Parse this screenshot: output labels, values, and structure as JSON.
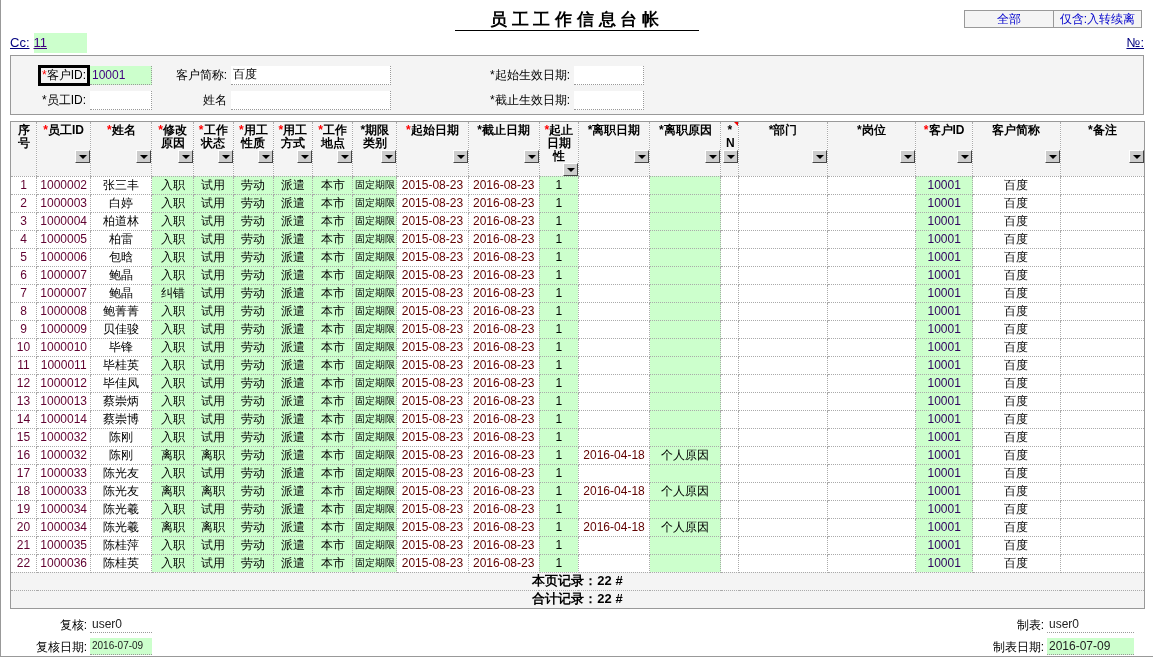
{
  "title": "员 工 工 作 信 息 台 帐",
  "filter_buttons": [
    {
      "label": "全部"
    },
    {
      "label": "仅含:入转续离"
    }
  ],
  "cc": {
    "label": "Cc:",
    "value": "11"
  },
  "number_label": "№:",
  "filters": [
    {
      "asterisk": "*",
      "required": true,
      "label": "客户ID:",
      "value": "10001",
      "highlight": true,
      "focused": true
    },
    {
      "label": "客户简称:",
      "value": "百度",
      "highlight": false,
      "focused": false
    },
    {
      "asterisk": "*",
      "required": false,
      "label": "起始生效日期:",
      "highlight": false,
      "focused": false
    },
    {
      "asterisk": "*",
      "required": false,
      "label": "员工ID:",
      "highlight": false,
      "focused": false
    },
    {
      "label": "姓名",
      "highlight": false,
      "focused": false
    },
    {
      "asterisk": "*",
      "required": false,
      "label": "截止生效日期:",
      "highlight": false,
      "focused": false
    }
  ],
  "table": {
    "columns": [
      {
        "label": "序号",
        "highlight": false,
        "dropdown": false
      },
      {
        "label": "员工ID",
        "asterisk": "*",
        "required": true,
        "highlight": false,
        "dropdown": true
      },
      {
        "label": "姓名",
        "asterisk": "*",
        "required": true,
        "highlight": false,
        "dropdown": true
      },
      {
        "label": "修改原因",
        "asterisk": "*",
        "required": true,
        "highlight": true,
        "dropdown": true
      },
      {
        "label": "工作状态",
        "asterisk": "*",
        "required": true,
        "highlight": true,
        "dropdown": true
      },
      {
        "label": "用工性质",
        "asterisk": "*",
        "required": true,
        "highlight": true,
        "dropdown": true
      },
      {
        "label": "用工方式",
        "asterisk": "*",
        "required": true,
        "highlight": true,
        "dropdown": true
      },
      {
        "label": "工作地点",
        "asterisk": "*",
        "required": true,
        "highlight": true,
        "dropdown": true
      },
      {
        "label": "期限类别",
        "asterisk": "*",
        "required": false,
        "highlight": true,
        "dropdown": true
      },
      {
        "label": "起始日期",
        "asterisk": "*",
        "required": true,
        "highlight": false,
        "dropdown": true
      },
      {
        "label": "截止日期",
        "asterisk": "*",
        "required": false,
        "highlight": false,
        "dropdown": true
      },
      {
        "label": "起止日期性",
        "asterisk": "*",
        "required": true,
        "highlight": true,
        "dropdown": true
      },
      {
        "label": "离职日期",
        "asterisk": "*",
        "required": false,
        "highlight": false,
        "dropdown": true
      },
      {
        "label": "离职原因",
        "asterisk": "*",
        "required": false,
        "highlight": true,
        "dropdown": true
      },
      {
        "label": "N",
        "asterisk": "*",
        "required": false,
        "highlight": false,
        "dropdown": true,
        "has_comment": true
      },
      {
        "label": "部门",
        "asterisk": "*",
        "required": false,
        "highlight": false,
        "dropdown": true
      },
      {
        "label": "岗位",
        "asterisk": "*",
        "required": false,
        "highlight": false,
        "dropdown": true
      },
      {
        "label": "客户ID",
        "asterisk": "*",
        "required": true,
        "highlight": true,
        "dropdown": true
      },
      {
        "label": "客户简称",
        "highlight": false,
        "dropdown": true
      },
      {
        "label": "备注",
        "asterisk": "*",
        "required": false,
        "highlight": false,
        "dropdown": true
      }
    ],
    "rows": [
      {
        "seq": "1",
        "emp_id": "1000002",
        "name": "张三丰",
        "reason": "入职",
        "status": "试用",
        "nature": "劳动",
        "mode": "派遣",
        "place": "本市",
        "term": "固定期限",
        "start": "2015-08-23",
        "end": "2016-08-23",
        "dnature": "1",
        "cust_id": "10001",
        "cust_name": "百度"
      },
      {
        "seq": "2",
        "emp_id": "1000003",
        "name": "白婷",
        "reason": "入职",
        "status": "试用",
        "nature": "劳动",
        "mode": "派遣",
        "place": "本市",
        "term": "固定期限",
        "start": "2015-08-23",
        "end": "2016-08-23",
        "dnature": "1",
        "cust_id": "10001",
        "cust_name": "百度"
      },
      {
        "seq": "3",
        "emp_id": "1000004",
        "name": "柏道林",
        "reason": "入职",
        "status": "试用",
        "nature": "劳动",
        "mode": "派遣",
        "place": "本市",
        "term": "固定期限",
        "start": "2015-08-23",
        "end": "2016-08-23",
        "dnature": "1",
        "cust_id": "10001",
        "cust_name": "百度"
      },
      {
        "seq": "4",
        "emp_id": "1000005",
        "name": "柏雷",
        "reason": "入职",
        "status": "试用",
        "nature": "劳动",
        "mode": "派遣",
        "place": "本市",
        "term": "固定期限",
        "start": "2015-08-23",
        "end": "2016-08-23",
        "dnature": "1",
        "cust_id": "10001",
        "cust_name": "百度"
      },
      {
        "seq": "5",
        "emp_id": "1000006",
        "name": "包晗",
        "reason": "入职",
        "status": "试用",
        "nature": "劳动",
        "mode": "派遣",
        "place": "本市",
        "term": "固定期限",
        "start": "2015-08-23",
        "end": "2016-08-23",
        "dnature": "1",
        "cust_id": "10001",
        "cust_name": "百度"
      },
      {
        "seq": "6",
        "emp_id": "1000007",
        "name": "鲍晶",
        "reason": "入职",
        "status": "试用",
        "nature": "劳动",
        "mode": "派遣",
        "place": "本市",
        "term": "固定期限",
        "start": "2015-08-23",
        "end": "2016-08-23",
        "dnature": "1",
        "cust_id": "10001",
        "cust_name": "百度"
      },
      {
        "seq": "7",
        "emp_id": "1000007",
        "name": "鲍晶",
        "reason": "纠错",
        "status": "试用",
        "nature": "劳动",
        "mode": "派遣",
        "place": "本市",
        "term": "固定期限",
        "start": "2015-08-23",
        "end": "2016-08-23",
        "dnature": "1",
        "cust_id": "10001",
        "cust_name": "百度"
      },
      {
        "seq": "8",
        "emp_id": "1000008",
        "name": "鲍菁菁",
        "reason": "入职",
        "status": "试用",
        "nature": "劳动",
        "mode": "派遣",
        "place": "本市",
        "term": "固定期限",
        "start": "2015-08-23",
        "end": "2016-08-23",
        "dnature": "1",
        "cust_id": "10001",
        "cust_name": "百度"
      },
      {
        "seq": "9",
        "emp_id": "1000009",
        "name": "贝佳骏",
        "reason": "入职",
        "status": "试用",
        "nature": "劳动",
        "mode": "派遣",
        "place": "本市",
        "term": "固定期限",
        "start": "2015-08-23",
        "end": "2016-08-23",
        "dnature": "1",
        "cust_id": "10001",
        "cust_name": "百度"
      },
      {
        "seq": "10",
        "emp_id": "1000010",
        "name": "毕锋",
        "reason": "入职",
        "status": "试用",
        "nature": "劳动",
        "mode": "派遣",
        "place": "本市",
        "term": "固定期限",
        "start": "2015-08-23",
        "end": "2016-08-23",
        "dnature": "1",
        "cust_id": "10001",
        "cust_name": "百度"
      },
      {
        "seq": "11",
        "emp_id": "1000011",
        "name": "毕桂英",
        "reason": "入职",
        "status": "试用",
        "nature": "劳动",
        "mode": "派遣",
        "place": "本市",
        "term": "固定期限",
        "start": "2015-08-23",
        "end": "2016-08-23",
        "dnature": "1",
        "cust_id": "10001",
        "cust_name": "百度"
      },
      {
        "seq": "12",
        "emp_id": "1000012",
        "name": "毕佳凤",
        "reason": "入职",
        "status": "试用",
        "nature": "劳动",
        "mode": "派遣",
        "place": "本市",
        "term": "固定期限",
        "start": "2015-08-23",
        "end": "2016-08-23",
        "dnature": "1",
        "cust_id": "10001",
        "cust_name": "百度"
      },
      {
        "seq": "13",
        "emp_id": "1000013",
        "name": "蔡崇炳",
        "reason": "入职",
        "status": "试用",
        "nature": "劳动",
        "mode": "派遣",
        "place": "本市",
        "term": "固定期限",
        "start": "2015-08-23",
        "end": "2016-08-23",
        "dnature": "1",
        "cust_id": "10001",
        "cust_name": "百度"
      },
      {
        "seq": "14",
        "emp_id": "1000014",
        "name": "蔡崇博",
        "reason": "入职",
        "status": "试用",
        "nature": "劳动",
        "mode": "派遣",
        "place": "本市",
        "term": "固定期限",
        "start": "2015-08-23",
        "end": "2016-08-23",
        "dnature": "1",
        "cust_id": "10001",
        "cust_name": "百度"
      },
      {
        "seq": "15",
        "emp_id": "1000032",
        "name": "陈刚",
        "reason": "入职",
        "status": "试用",
        "nature": "劳动",
        "mode": "派遣",
        "place": "本市",
        "term": "固定期限",
        "start": "2015-08-23",
        "end": "2016-08-23",
        "dnature": "1",
        "cust_id": "10001",
        "cust_name": "百度"
      },
      {
        "seq": "16",
        "emp_id": "1000032",
        "name": "陈刚",
        "reason": "离职",
        "status": "离职",
        "nature": "劳动",
        "mode": "派遣",
        "place": "本市",
        "term": "固定期限",
        "start": "2015-08-23",
        "end": "2016-08-23",
        "dnature": "1",
        "leave_date": "2016-04-18",
        "leave_reason": "个人原因",
        "cust_id": "10001",
        "cust_name": "百度"
      },
      {
        "seq": "17",
        "emp_id": "1000033",
        "name": "陈光友",
        "reason": "入职",
        "status": "试用",
        "nature": "劳动",
        "mode": "派遣",
        "place": "本市",
        "term": "固定期限",
        "start": "2015-08-23",
        "end": "2016-08-23",
        "dnature": "1",
        "cust_id": "10001",
        "cust_name": "百度"
      },
      {
        "seq": "18",
        "emp_id": "1000033",
        "name": "陈光友",
        "reason": "离职",
        "status": "离职",
        "nature": "劳动",
        "mode": "派遣",
        "place": "本市",
        "term": "固定期限",
        "start": "2015-08-23",
        "end": "2016-08-23",
        "dnature": "1",
        "leave_date": "2016-04-18",
        "leave_reason": "个人原因",
        "cust_id": "10001",
        "cust_name": "百度"
      },
      {
        "seq": "19",
        "emp_id": "1000034",
        "name": "陈光羲",
        "reason": "入职",
        "status": "试用",
        "nature": "劳动",
        "mode": "派遣",
        "place": "本市",
        "term": "固定期限",
        "start": "2015-08-23",
        "end": "2016-08-23",
        "dnature": "1",
        "cust_id": "10001",
        "cust_name": "百度"
      },
      {
        "seq": "20",
        "emp_id": "1000034",
        "name": "陈光羲",
        "reason": "离职",
        "status": "离职",
        "nature": "劳动",
        "mode": "派遣",
        "place": "本市",
        "term": "固定期限",
        "start": "2015-08-23",
        "end": "2016-08-23",
        "dnature": "1",
        "leave_date": "2016-04-18",
        "leave_reason": "个人原因",
        "cust_id": "10001",
        "cust_name": "百度"
      },
      {
        "seq": "21",
        "emp_id": "1000035",
        "name": "陈桂萍",
        "reason": "入职",
        "status": "试用",
        "nature": "劳动",
        "mode": "派遣",
        "place": "本市",
        "term": "固定期限",
        "start": "2015-08-23",
        "end": "2016-08-23",
        "dnature": "1",
        "cust_id": "10001",
        "cust_name": "百度"
      },
      {
        "seq": "22",
        "emp_id": "1000036",
        "name": "陈桂英",
        "reason": "入职",
        "status": "试用",
        "nature": "劳动",
        "mode": "派遣",
        "place": "本市",
        "term": "固定期限",
        "start": "2015-08-23",
        "end": "2016-08-23",
        "dnature": "1",
        "cust_id": "10001",
        "cust_name": "百度"
      }
    ],
    "summary": [
      "本页记录：22 #",
      "合计记录：22 #"
    ]
  },
  "footer": {
    "left": [
      {
        "label": "复核:",
        "value": "user0",
        "highlight": false
      },
      {
        "label": "复核日期:",
        "value": "2016-07-09",
        "highlight": true
      }
    ],
    "right": [
      {
        "label": "制表:",
        "value": "user0",
        "highlight": false
      },
      {
        "label": "制表日期:",
        "value": "2016-07-09",
        "highlight": true
      }
    ]
  }
}
